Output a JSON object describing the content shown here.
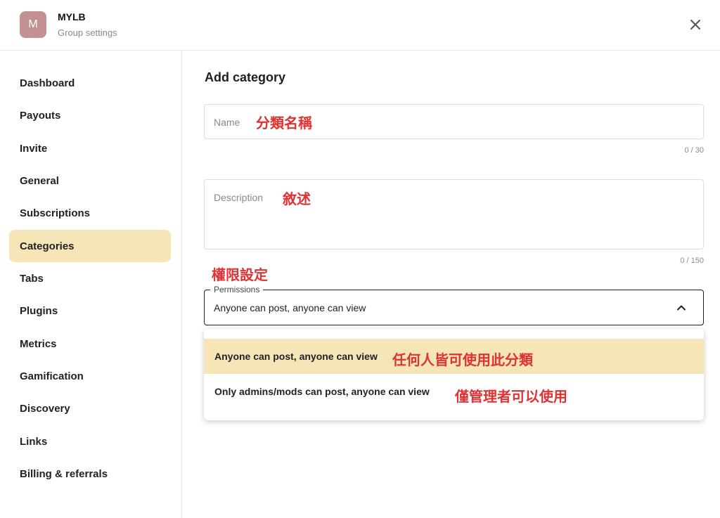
{
  "header": {
    "avatar_letter": "M",
    "group_name": "MYLB",
    "group_subtitle": "Group settings",
    "close_icon": "close-icon"
  },
  "sidebar": {
    "items": [
      {
        "label": "Dashboard"
      },
      {
        "label": "Payouts"
      },
      {
        "label": "Invite"
      },
      {
        "label": "General"
      },
      {
        "label": "Subscriptions"
      },
      {
        "label": "Categories",
        "active": true
      },
      {
        "label": "Tabs"
      },
      {
        "label": "Plugins"
      },
      {
        "label": "Metrics"
      },
      {
        "label": "Gamification"
      },
      {
        "label": "Discovery"
      },
      {
        "label": "Links"
      },
      {
        "label": "Billing & referrals"
      }
    ]
  },
  "main": {
    "title": "Add category",
    "name_field": {
      "placeholder": "Name",
      "annotation": "分類名稱",
      "counter": "0 / 30"
    },
    "description_field": {
      "placeholder": "Description",
      "annotation": "敘述",
      "counter": "0 / 150"
    },
    "permissions_annotation": "權限設定",
    "permissions_select": {
      "legend": "Permissions",
      "value": "Anyone can post, anyone can view",
      "chevron_icon": "chevron-up-icon",
      "options": [
        {
          "label": "Anyone can post, anyone can view",
          "annotation": "任何人皆可使用此分類",
          "selected": true
        },
        {
          "label": "Only admins/mods can post, anyone can view",
          "annotation": "僅管理者可以使用"
        }
      ]
    }
  },
  "colors": {
    "accent_highlight": "#f6e5b7",
    "avatar_bg": "#c29292",
    "annotation_red": "#e03232"
  }
}
